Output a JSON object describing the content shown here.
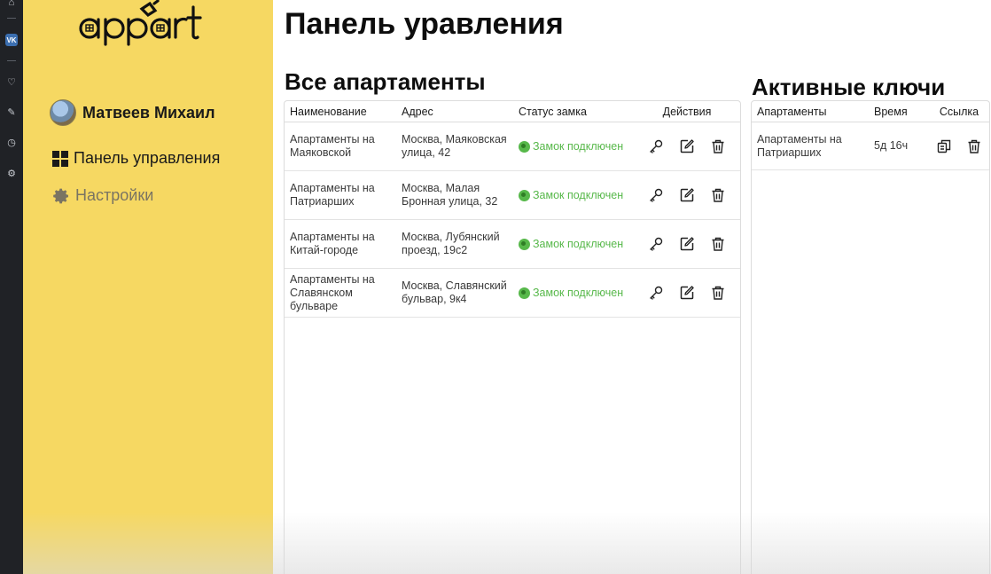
{
  "app": {
    "logo_text": "appart"
  },
  "user": {
    "name": "Матвеев Михаил"
  },
  "nav": {
    "dashboard": "Панель управления",
    "settings": "Настройки"
  },
  "page": {
    "title": "Панель уравления"
  },
  "apartments": {
    "title": "Все апартаменты",
    "columns": [
      "Наименование",
      "Адрес",
      "Статус замка",
      "Действия"
    ],
    "rows": [
      {
        "name": "Апартаменты на Маяковской",
        "address": "Москва, Маяковская улица, 42",
        "status": "Замок подключен"
      },
      {
        "name": "Апартаменты на Патриарших",
        "address": "Москва, Малая Бронная улица, 32",
        "status": "Замок подключен"
      },
      {
        "name": "Апартаменты на Китай-городе",
        "address": "Москва, Лубянский проезд, 19с2",
        "status": "Замок подключен"
      },
      {
        "name": "Апартаменты на Славянском бульваре",
        "address": "Москва, Славянский бульвар, 9к4",
        "status": "Замок подключен"
      }
    ]
  },
  "keys": {
    "title": "Активные ключи",
    "columns": [
      "Апартаменты",
      "Время",
      "Ссылка"
    ],
    "rows": [
      {
        "apartment": "Апартаменты на Патриарших",
        "time": "5д 16ч"
      }
    ]
  },
  "colors": {
    "sidebar": "#f6d862",
    "status_ok": "#57b84a",
    "rail": "#202226"
  }
}
